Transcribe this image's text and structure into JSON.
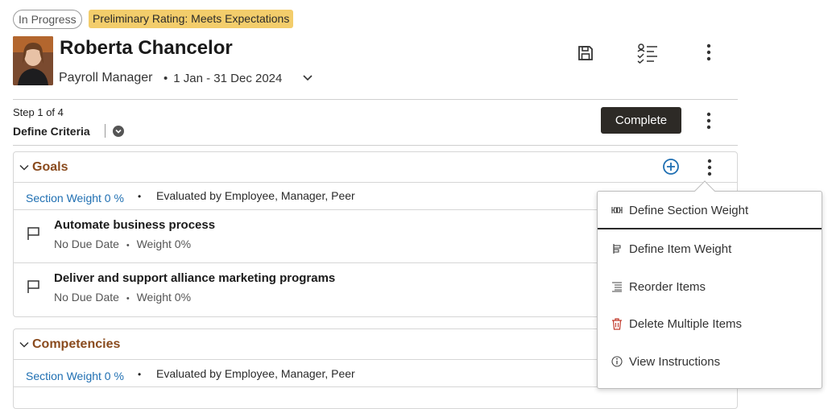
{
  "header": {
    "status_badge": "In Progress",
    "rating_badge": "Preliminary Rating: Meets Expectations",
    "name": "Roberta Chancelor",
    "role": "Payroll Manager",
    "period_separator": "•",
    "period": "1 Jan - 31 Dec 2024"
  },
  "step": {
    "label": "Step 1 of 4",
    "name": "Define Criteria",
    "complete_label": "Complete"
  },
  "sections": {
    "goals": {
      "title": "Goals",
      "weight": "Section Weight 0 %",
      "separator": "•",
      "evaluated": "Evaluated by Employee, Manager, Peer",
      "items": [
        {
          "title": "Automate business process",
          "due": "No Due Date",
          "sep": "•",
          "weight": "Weight 0%"
        },
        {
          "title": "Deliver and support alliance marketing programs",
          "due": "No Due Date",
          "sep": "•",
          "weight": "Weight 0%"
        }
      ]
    },
    "competencies": {
      "title": "Competencies",
      "weight": "Section Weight 0 %",
      "separator": "•",
      "evaluated": "Evaluated by Employee, Manager, Peer"
    }
  },
  "menu": {
    "items": [
      {
        "label": "Define Section Weight",
        "icon": "section-weight-icon"
      },
      {
        "label": "Define Item Weight",
        "icon": "item-weight-icon"
      },
      {
        "label": "Reorder Items",
        "icon": "reorder-icon"
      },
      {
        "label": "Delete Multiple Items",
        "icon": "trash-icon"
      },
      {
        "label": "View Instructions",
        "icon": "info-icon"
      }
    ]
  },
  "colors": {
    "section_title": "#8a4b1e",
    "link": "#1f6fb2",
    "rating_badge": "#f3cd6b",
    "complete_button": "#2d2a26",
    "add_icon": "#1f6fb2",
    "delete_icon": "#c0392b"
  }
}
